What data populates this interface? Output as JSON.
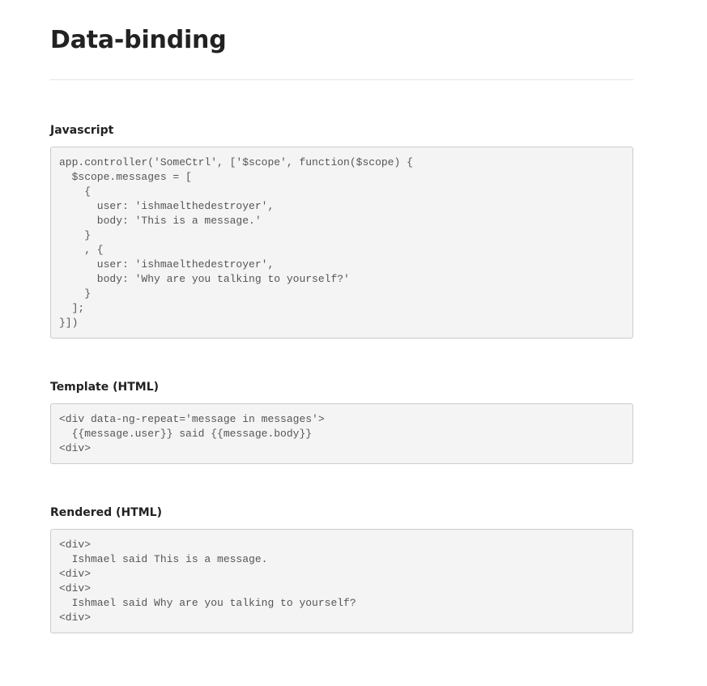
{
  "page": {
    "title": "Data-binding"
  },
  "sections": [
    {
      "heading": "Javascript",
      "code": "app.controller('SomeCtrl', ['$scope', function($scope) {\n  $scope.messages = [\n    {\n      user: 'ishmaelthedestroyer',\n      body: 'This is a message.'\n    }\n    , {\n      user: 'ishmaelthedestroyer',\n      body: 'Why are you talking to yourself?'\n    }\n  ];\n}])"
    },
    {
      "heading": "Template (HTML)",
      "code": "<div data-ng-repeat='message in messages'>\n  {{message.user}} said {{message.body}}\n<div>"
    },
    {
      "heading": "Rendered (HTML)",
      "code": "<div>\n  Ishmael said This is a message.\n<div>\n<div>\n  Ishmael said Why are you talking to yourself?\n<div>"
    }
  ]
}
